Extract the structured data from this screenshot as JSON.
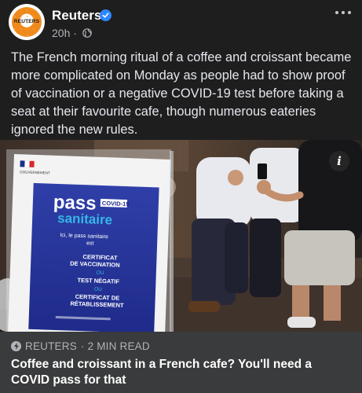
{
  "post": {
    "author": "Reuters",
    "avatar_text": "REUTERS",
    "time": "20h",
    "separator": "·",
    "caption": "The French morning ritual of a coffee and croissant became more complicated on Monday as people had to show proof of vaccination or a negative COVID-19 test before taking a seat at their favourite cafe, though numerous eateries ignored the new rules."
  },
  "photo": {
    "info_label": "i",
    "sign": {
      "header": "GOUVERNEMENT",
      "pass_word": "pass",
      "covid_badge": "COVID-19",
      "sanitaire_word": "sanitaire",
      "line1": "Ici, le pass sanitaire",
      "line2": "est",
      "cert_vacc_1": "CERTIFICAT",
      "cert_vacc_2": "DE VACCINATION",
      "ou1": "OU",
      "test": "TEST NÉGATIF",
      "ou2": "OU",
      "cert_retab_1": "CERTIFICAT DE",
      "cert_retab_2": "RÉTABLISSEMENT"
    }
  },
  "link": {
    "source": "REUTERS",
    "read_time": "· 2 MIN READ",
    "title": "Coffee and croissant in a French cafe? You'll need a COVID pass for that"
  },
  "colors": {
    "background": "#1e1e1f",
    "link_bar": "#3a3b3c",
    "verified": "#2d88ff",
    "brand_orange": "#f18a1c"
  },
  "icons": [
    "verified-badge-icon",
    "globe-icon",
    "more-options-icon",
    "info-icon",
    "lightning-bolt-icon"
  ]
}
